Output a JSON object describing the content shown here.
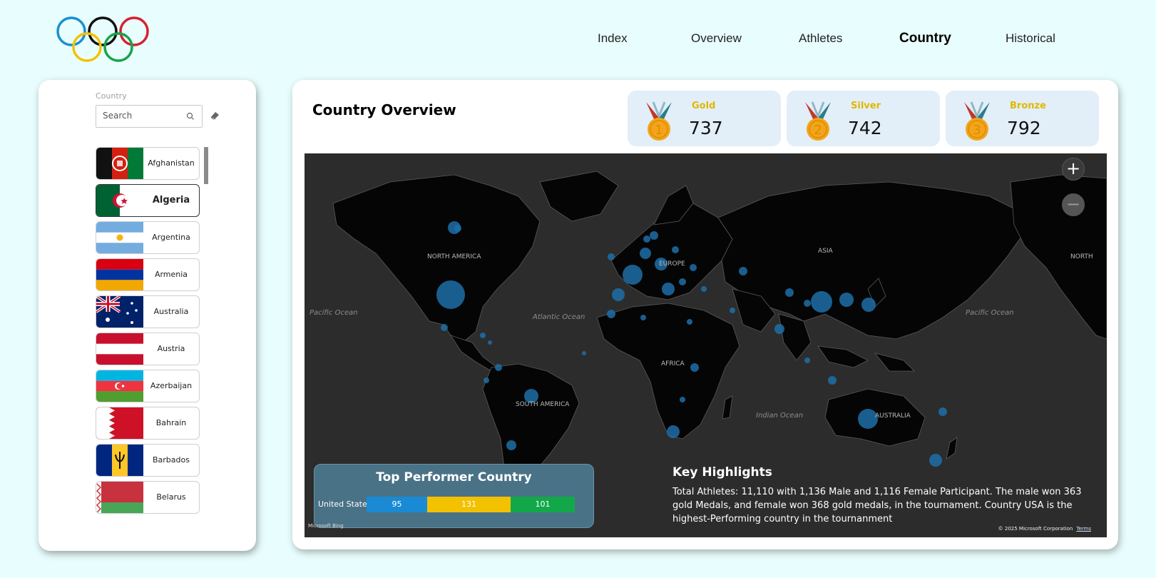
{
  "nav": {
    "items": [
      "Index",
      "Overview",
      "Athletes",
      "Country",
      "Historical"
    ],
    "active": "Country"
  },
  "slicer": {
    "label": "Country",
    "search_placeholder": "Search",
    "countries": [
      {
        "name": "Afghanistan",
        "selected": false,
        "flag": "afghanistan-flag"
      },
      {
        "name": "Algeria",
        "selected": true,
        "flag": "algeria-flag"
      },
      {
        "name": "Argentina",
        "selected": false,
        "flag": "argentina-flag"
      },
      {
        "name": "Armenia",
        "selected": false,
        "flag": "armenia-flag"
      },
      {
        "name": "Australia",
        "selected": false,
        "flag": "australia-flag"
      },
      {
        "name": "Austria",
        "selected": false,
        "flag": "austria-flag"
      },
      {
        "name": "Azerbaijan",
        "selected": false,
        "flag": "azerbaijan-flag"
      },
      {
        "name": "Bahrain",
        "selected": false,
        "flag": "bahrain-flag"
      },
      {
        "name": "Barbados",
        "selected": false,
        "flag": "barbados-flag"
      },
      {
        "name": "Belarus",
        "selected": false,
        "flag": "belarus-flag"
      }
    ]
  },
  "main": {
    "title": "Country Overview",
    "medals": [
      {
        "label": "Gold",
        "value": "737",
        "number": "1"
      },
      {
        "label": "Silver",
        "value": "742",
        "number": "2"
      },
      {
        "label": "Bronze",
        "value": "792",
        "number": "3"
      }
    ]
  },
  "map": {
    "labels": {
      "north_america": "NORTH AMERICA",
      "north_right": "NORTH",
      "asia": "ASIA",
      "europe": "EUROPE",
      "africa": "AFRICA",
      "south_america": "SOUTH AMERICA",
      "australia": "AUSTRALIA",
      "pacific_left": "Pacific Ocean",
      "pacific_right": "Pacific Ocean",
      "atlantic": "Atlantic Ocean",
      "indian": "Indian Ocean"
    },
    "zoom_in": "+",
    "zoom_out": "−",
    "bing": "Microsoft Bing",
    "copyright": "© 2025 Microsoft Corporation",
    "terms": "Terms",
    "bubble_color": "#1e6fa8"
  },
  "top_performer": {
    "title": "Top Performer Country",
    "country": "United States",
    "gold": "95",
    "silver": "131",
    "bronze": "101",
    "colors": {
      "gold": "#1a8ad4",
      "silver": "#f2c100",
      "bronze": "#12a84a"
    }
  },
  "highlights": {
    "title": "Key Highlights",
    "body": "Total Athletes: 11,110 with 1,136 Male and 1,116 Female Participant. The male won 363 gold Medals, and female won 368 gold medals, in the tournament. Country USA is the highest-Performing country in the tournanment"
  }
}
